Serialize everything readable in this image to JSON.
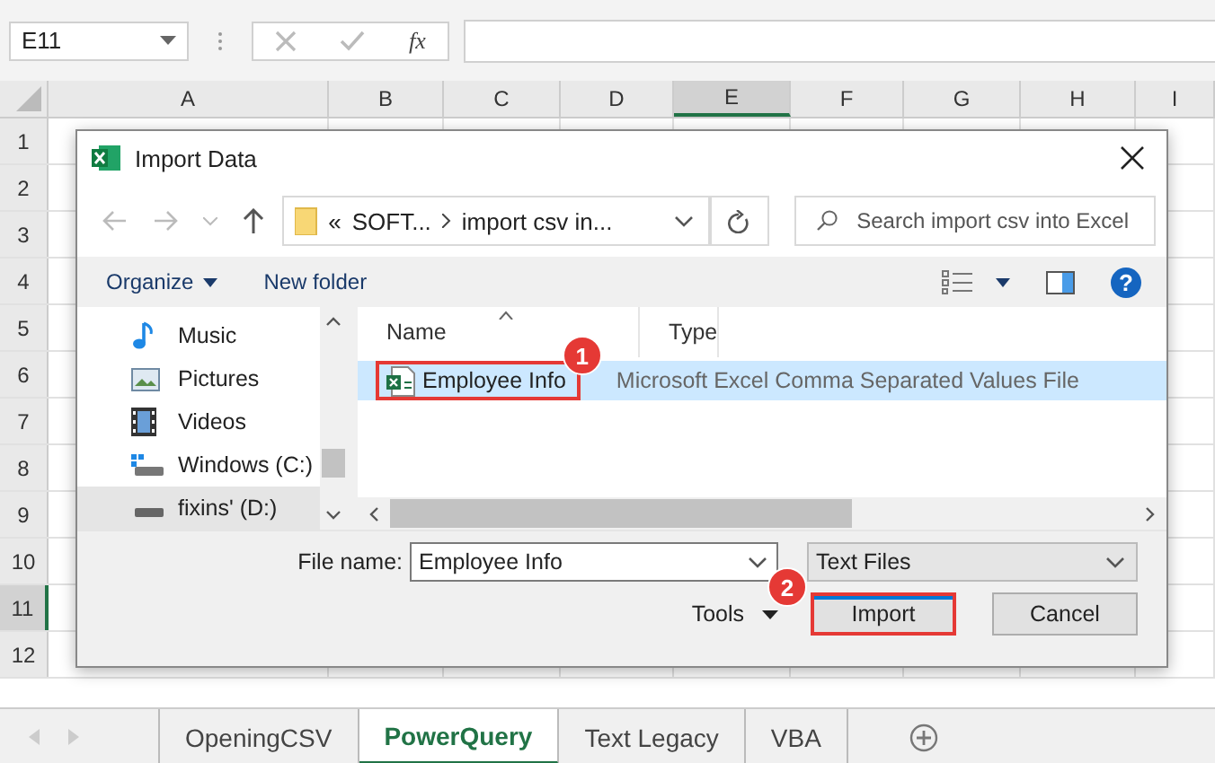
{
  "formula_bar": {
    "name_box": "E11",
    "function_label": "fx"
  },
  "columns": [
    {
      "label": "A",
      "selected": false
    },
    {
      "label": "B",
      "selected": false
    },
    {
      "label": "C",
      "selected": false
    },
    {
      "label": "D",
      "selected": false
    },
    {
      "label": "E",
      "selected": true
    },
    {
      "label": "F",
      "selected": false
    },
    {
      "label": "G",
      "selected": false
    },
    {
      "label": "H",
      "selected": false
    },
    {
      "label": "I",
      "selected": false
    }
  ],
  "rows": [
    {
      "label": "1",
      "selected": false
    },
    {
      "label": "2",
      "selected": false
    },
    {
      "label": "3",
      "selected": false
    },
    {
      "label": "4",
      "selected": false
    },
    {
      "label": "5",
      "selected": false
    },
    {
      "label": "6",
      "selected": false
    },
    {
      "label": "7",
      "selected": false
    },
    {
      "label": "8",
      "selected": false
    },
    {
      "label": "9",
      "selected": false
    },
    {
      "label": "10",
      "selected": false
    },
    {
      "label": "11",
      "selected": true
    },
    {
      "label": "12",
      "selected": false
    }
  ],
  "dialog": {
    "title": "Import Data",
    "address": {
      "crumbs": [
        "SOFT...",
        "import csv in..."
      ],
      "prefix": "«"
    },
    "search": {
      "placeholder": "Search import csv into Excel"
    },
    "toolbar": {
      "organize": "Organize",
      "new_folder": "New folder",
      "help": "?"
    },
    "sidebar": [
      {
        "label": "Music",
        "kind": "music",
        "selected": false
      },
      {
        "label": "Pictures",
        "kind": "pictures",
        "selected": false
      },
      {
        "label": "Videos",
        "kind": "videos",
        "selected": false
      },
      {
        "label": "Windows (C:)",
        "kind": "system-drive",
        "selected": false
      },
      {
        "label": "fixins' (D:)",
        "kind": "drive",
        "selected": true
      }
    ],
    "file_columns": [
      "Name",
      "Type"
    ],
    "files": [
      {
        "name": "Employee Info",
        "type": "Microsoft Excel Comma Separated Values File",
        "selected": true,
        "badge": "1"
      }
    ],
    "file_name_label": "File name:",
    "file_name": "Employee Info",
    "file_type": "Text Files",
    "tools": "Tools",
    "import_button": {
      "label": "Import",
      "badge": "2"
    },
    "cancel_button": "Cancel"
  },
  "sheet_tabs": [
    {
      "label": "OpeningCSV",
      "selected": false
    },
    {
      "label": "PowerQuery",
      "selected": true
    },
    {
      "label": "Text Legacy",
      "selected": false
    },
    {
      "label": "VBA",
      "selected": false
    }
  ]
}
